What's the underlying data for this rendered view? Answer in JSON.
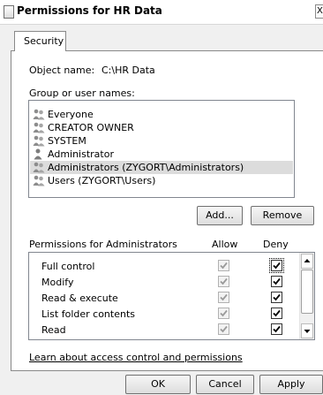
{
  "window": {
    "title": "Permissions for HR Data",
    "close_glyph": "X"
  },
  "tabs": [
    {
      "label": "Security"
    }
  ],
  "object": {
    "label": "Object name:",
    "value": "C:\\HR Data"
  },
  "groups": {
    "label": "Group or user names:",
    "items": [
      {
        "name": "Everyone",
        "icon": "group-icon"
      },
      {
        "name": "CREATOR OWNER",
        "icon": "group-icon"
      },
      {
        "name": "SYSTEM",
        "icon": "group-icon"
      },
      {
        "name": "Administrator",
        "icon": "user-icon"
      },
      {
        "name": "Administrators (ZYGORT\\Administrators)",
        "icon": "group-icon",
        "selected": true
      },
      {
        "name": "Users (ZYGORT\\Users)",
        "icon": "group-icon"
      }
    ]
  },
  "buttons": {
    "add": "Add...",
    "remove": "Remove",
    "ok": "OK",
    "cancel": "Cancel",
    "apply": "Apply"
  },
  "permissions": {
    "header": "Permissions for Administrators",
    "allow_label": "Allow",
    "deny_label": "Deny",
    "rows": [
      {
        "name": "Full control",
        "allow": true,
        "deny": true
      },
      {
        "name": "Modify",
        "allow": true,
        "deny": true
      },
      {
        "name": "Read & execute",
        "allow": true,
        "deny": true
      },
      {
        "name": "List folder contents",
        "allow": true,
        "deny": true
      },
      {
        "name": "Read",
        "allow": true,
        "deny": true
      }
    ]
  },
  "link": {
    "text": "Learn about access control and permissions"
  },
  "colors": {
    "selection": "#dcdcdc",
    "window_bg": "#f0f0f0",
    "border": "#898989"
  }
}
